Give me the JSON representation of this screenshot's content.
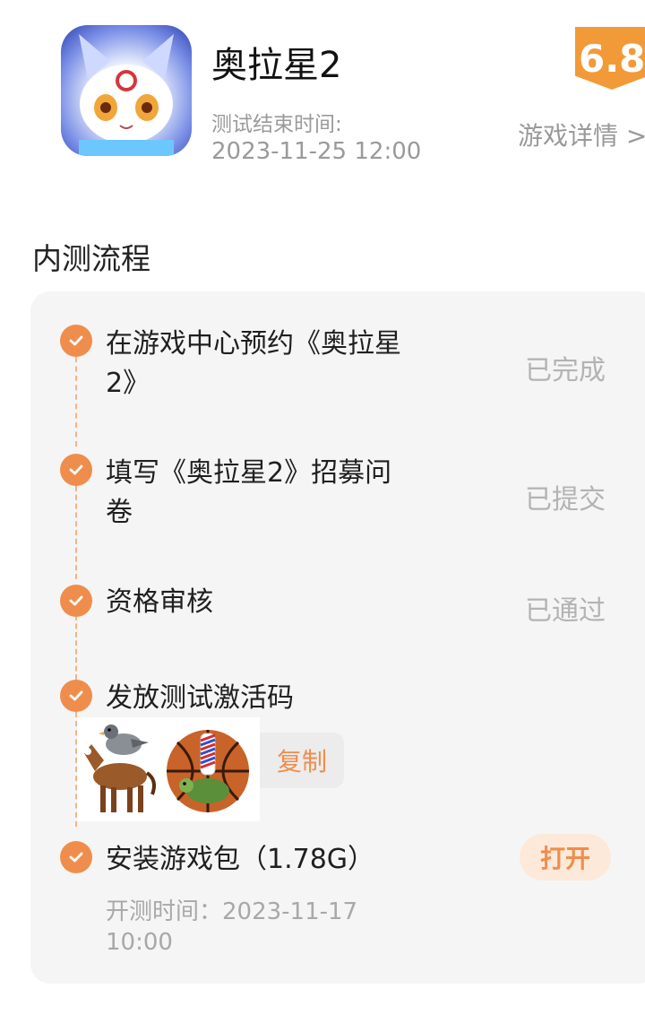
{
  "header": {
    "game_title": "奥拉星2",
    "end_time_label": "测试结束时间:",
    "end_time_value": "2023-11-25 12:00",
    "score": "6.8",
    "detail_link": "游戏详情 >"
  },
  "process": {
    "section_title": "内测流程",
    "steps": [
      {
        "title": "在游戏中心预约《奥拉星2》",
        "status": "已完成"
      },
      {
        "title": "填写《奥拉星2》招募问卷",
        "status": "已提交"
      },
      {
        "title": "资格审核",
        "status": "已通过"
      },
      {
        "title": "发放测试激活码",
        "copy_label": "复制"
      },
      {
        "title": "安装游戏包（1.78G）",
        "open_label": "打开",
        "open_time": "开测时间：2023-11-17 10:00"
      }
    ]
  },
  "colors": {
    "accent": "#ef8e4c",
    "score_badge": "#f29a38",
    "card_bg": "#f5f5f5",
    "muted_text": "#b3b3b3"
  },
  "icons": [
    "app-icon",
    "check-icon",
    "chevron-right-icon",
    "horse-sticker",
    "pigeon-sticker",
    "basketball-sticker",
    "turtle-sticker"
  ]
}
